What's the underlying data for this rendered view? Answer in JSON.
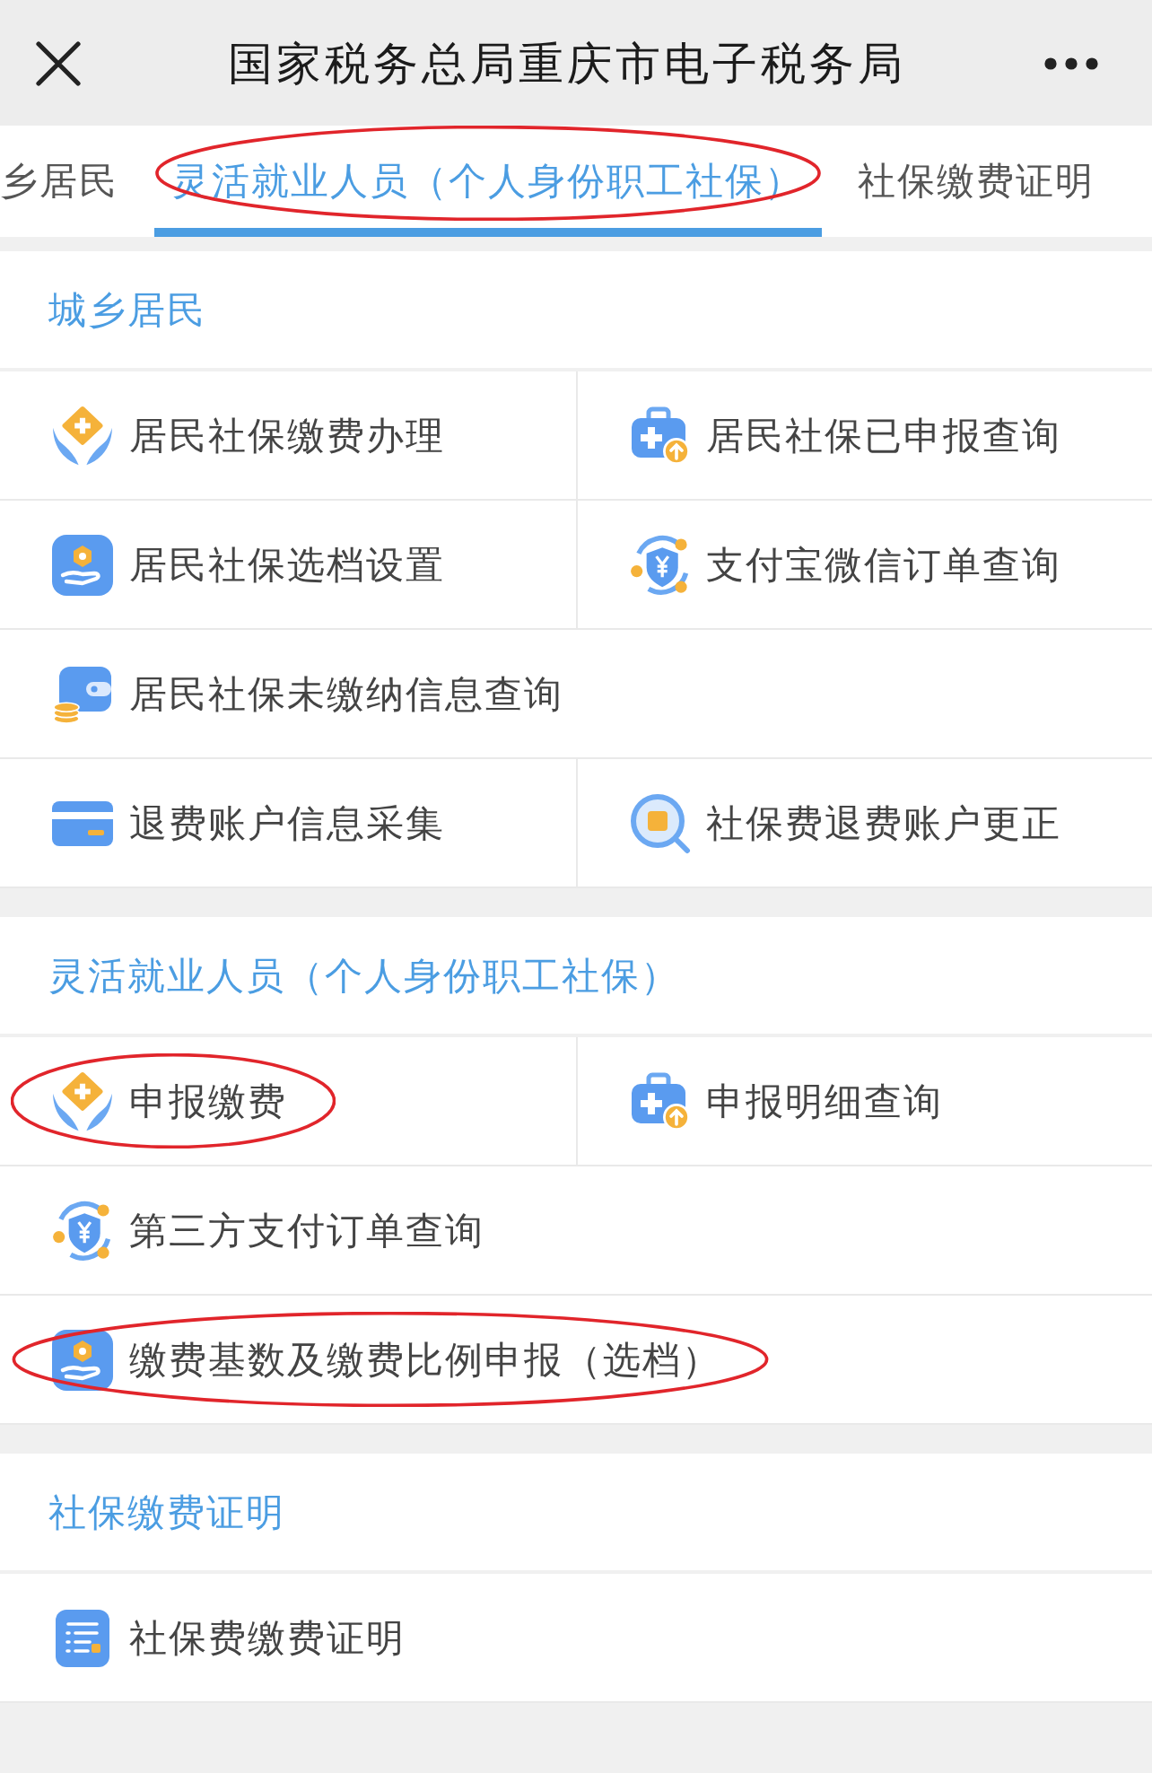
{
  "top_bar": {
    "title": "国家税务总局重庆市电子税务局"
  },
  "tabs": [
    {
      "label": "乡居民",
      "selected": false,
      "circled": false
    },
    {
      "label": "灵活就业人员（个人身份职工社保）",
      "selected": true,
      "circled": true
    },
    {
      "label": "社保缴费证明",
      "selected": false,
      "circled": false
    }
  ],
  "sections": [
    {
      "title": "城乡居民",
      "rows": [
        {
          "items": [
            {
              "kind": "pay",
              "label": "居民社保缴费办理",
              "circled": false
            },
            {
              "kind": "record",
              "label": "居民社保已申报查询",
              "circled": false
            }
          ]
        },
        {
          "items": [
            {
              "kind": "grade",
              "label": "居民社保选档设置",
              "circled": false
            },
            {
              "kind": "order",
              "label": "支付宝微信订单查询",
              "circled": false
            }
          ]
        },
        {
          "items": [
            {
              "kind": "arrears",
              "label": "居民社保未缴纳信息查询",
              "circled": false
            }
          ]
        },
        {
          "items": [
            {
              "kind": "account",
              "label": "退费账户信息采集",
              "circled": false
            },
            {
              "kind": "refund",
              "label": "社保费退费账户更正",
              "circled": false
            }
          ]
        }
      ]
    },
    {
      "title": "灵活就业人员（个人身份职工社保）",
      "rows": [
        {
          "items": [
            {
              "kind": "pay",
              "label": "申报缴费",
              "circled": true
            },
            {
              "kind": "record",
              "label": "申报明细查询",
              "circled": false
            }
          ]
        },
        {
          "items": [
            {
              "kind": "order",
              "label": "第三方支付订单查询",
              "circled": false
            }
          ]
        },
        {
          "items": [
            {
              "kind": "grade",
              "label": "缴费基数及缴费比例申报（选档）",
              "circled": true
            }
          ]
        }
      ]
    },
    {
      "title": "社保缴费证明",
      "rows": [
        {
          "items": [
            {
              "kind": "certificate",
              "label": "社保费缴费证明",
              "circled": false
            }
          ]
        }
      ]
    }
  ]
}
